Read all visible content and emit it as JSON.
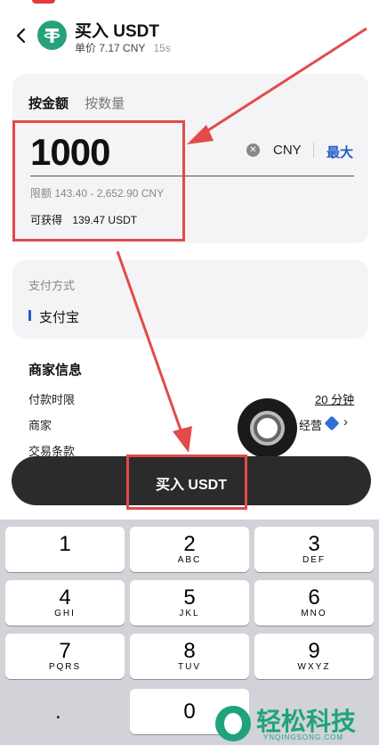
{
  "header": {
    "title": "买入 USDT",
    "unit_price": "单价 7.17 CNY",
    "countdown": "15s"
  },
  "amount_card": {
    "tabs": [
      "按金额",
      "按数量"
    ],
    "amount": "1000",
    "currency": "CNY",
    "max_label": "最大",
    "limit_text": "限额 143.40 - 2,652.90 CNY",
    "receive_label": "可获得",
    "receive_value": "139.47 USDT"
  },
  "payment": {
    "label": "支付方式",
    "value": "支付宝"
  },
  "merchant": {
    "title": "商家信息",
    "payment_time_label": "付款时限",
    "payment_time_value": "20 分钟",
    "merchant_label": "商家",
    "merchant_value": "经营",
    "terms_label": "交易条款"
  },
  "buy_button": {
    "label": "买入 USDT"
  },
  "keypad": {
    "keys": [
      {
        "num": "1",
        "letters": ""
      },
      {
        "num": "2",
        "letters": "ABC"
      },
      {
        "num": "3",
        "letters": "DEF"
      },
      {
        "num": "4",
        "letters": "GHI"
      },
      {
        "num": "5",
        "letters": "JKL"
      },
      {
        "num": "6",
        "letters": "MNO"
      },
      {
        "num": "7",
        "letters": "PQRS"
      },
      {
        "num": "8",
        "letters": "TUV"
      },
      {
        "num": "9",
        "letters": "WXYZ"
      }
    ],
    "dot": ".",
    "zero": "0"
  },
  "watermark": {
    "text": "轻松科技",
    "sub": "YNQINGSONG.COM"
  },
  "colors": {
    "accent_blue": "#1f5cc7",
    "highlight_red": "#e34a4a",
    "tether_green": "#26a17b"
  }
}
